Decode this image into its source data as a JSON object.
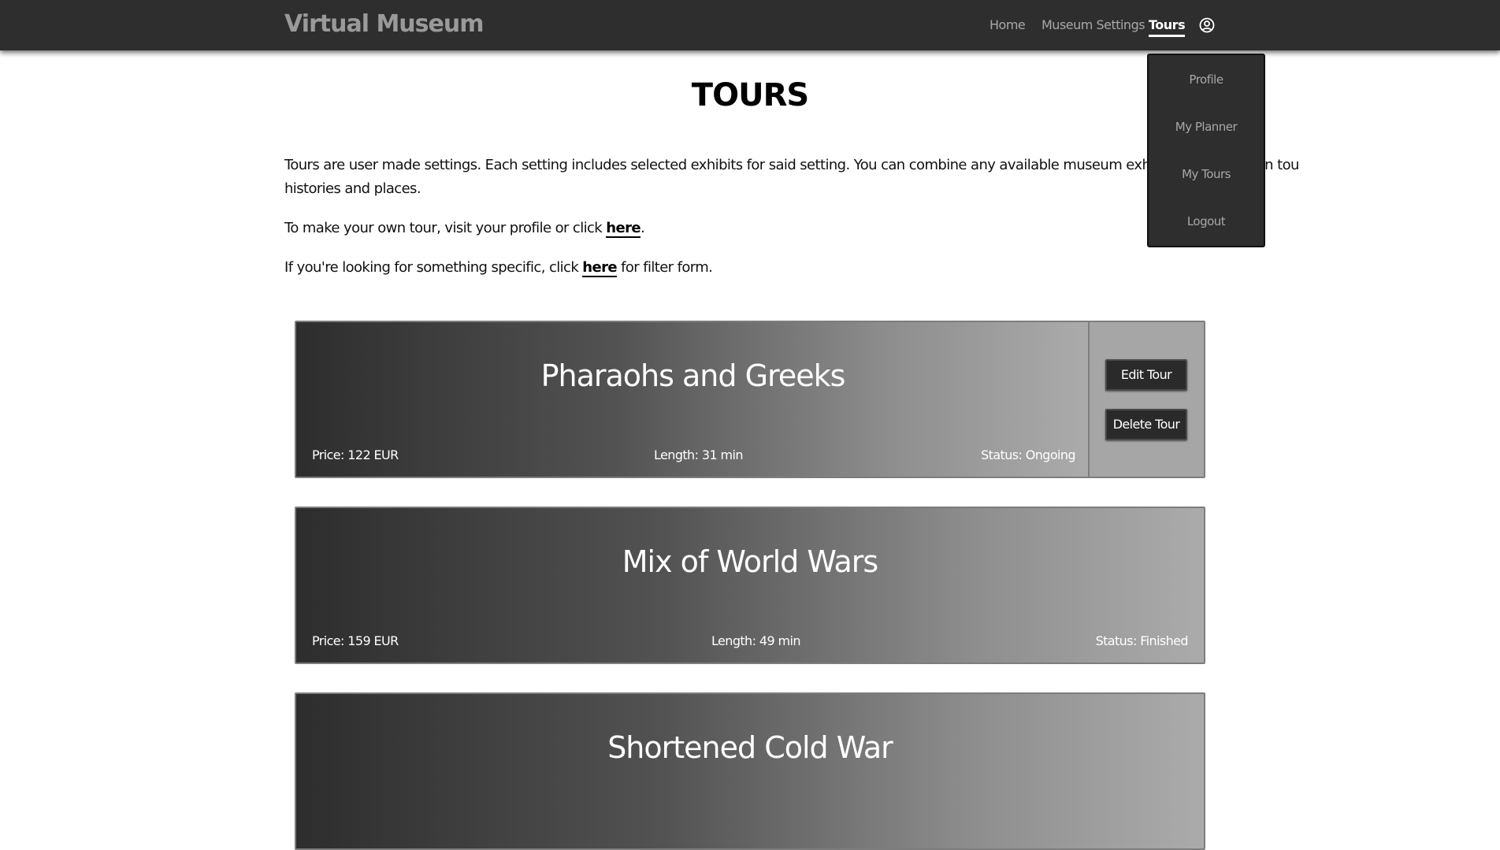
{
  "header": {
    "brand": "Virtual Museum",
    "nav": [
      {
        "label": "Home"
      },
      {
        "label": "Museum Settings"
      },
      {
        "label": "Tours",
        "active": true
      }
    ],
    "user_icon": "user-circle-icon"
  },
  "user_menu": {
    "items": [
      {
        "label": "Profile"
      },
      {
        "label": "My Planner"
      },
      {
        "label": "My Tours"
      },
      {
        "label": "Logout"
      }
    ]
  },
  "page": {
    "title": "TOURS",
    "intro_line1": "Tours are user made settings. Each setting includes selected exhibits for said setting. You can combine any available museum exhibits into your own tou",
    "intro_line2": "histories and places.",
    "make_tour_prefix": "To make your own tour, visit your profile or click ",
    "make_tour_link": "here",
    "make_tour_suffix": ".",
    "filter_prefix": "If you're looking for something specific, click ",
    "filter_link": "here",
    "filter_suffix": " for filter form."
  },
  "tours": [
    {
      "title": "Pharaohs and Greeks",
      "price": "Price: 122 EUR",
      "length": "Length: 31 min",
      "status": "Status: Ongoing",
      "edit_label": "Edit Tour",
      "delete_label": "Delete Tour"
    },
    {
      "title": "Mix of World Wars",
      "price": "Price: 159 EUR",
      "length": "Length: 49 min",
      "status": "Status: Finished"
    },
    {
      "title": "Shortened Cold War"
    }
  ],
  "colors": {
    "topbar": "#2e2e2e",
    "nav_text": "#a8a8a8",
    "card_gradient_start": "#2d2d2d",
    "card_gradient_end": "#ababab",
    "button_bg": "#2a2a2a"
  }
}
